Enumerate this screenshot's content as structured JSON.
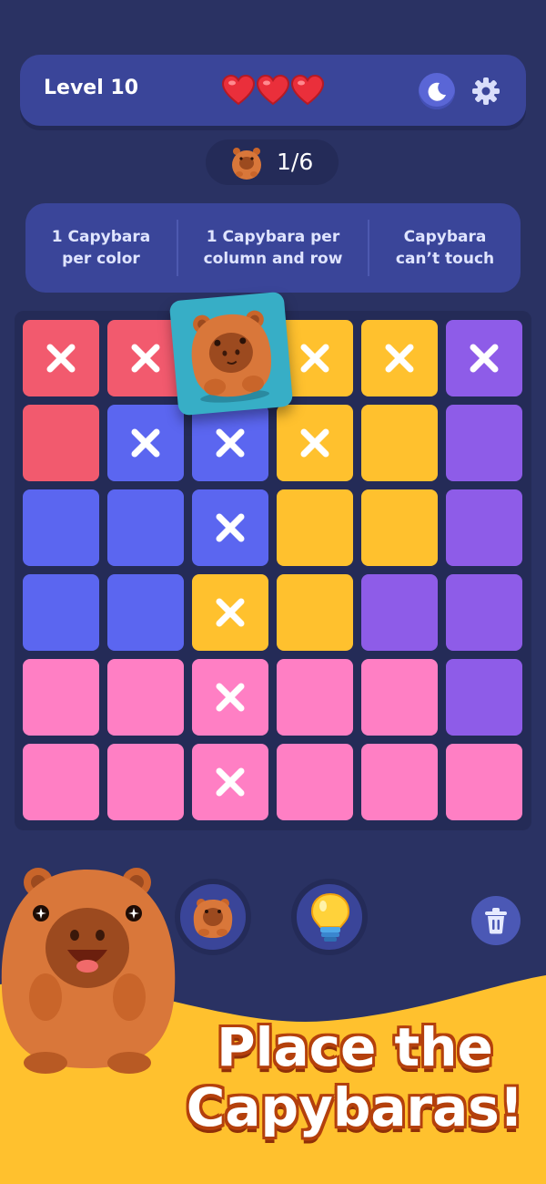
{
  "header": {
    "level_label": "Level 10",
    "lives": 3,
    "theme_icon": "moon-icon",
    "settings_icon": "gear-icon"
  },
  "counter": {
    "text": "1/6",
    "icon": "capybara-icon"
  },
  "rules": [
    {
      "text": "1 Capybara per color"
    },
    {
      "text": "1 Capybara per column and row"
    },
    {
      "text": "Capybara can’t touch"
    }
  ],
  "board": {
    "colors": {
      "red": "#f25a6e",
      "blue": "#5b66f0",
      "yellow": "#ffc12e",
      "purple": "#8e5ce8",
      "pink": "#ff7fc4",
      "selected": "#3ab3c9"
    },
    "rows": [
      [
        "red:x",
        "red:x",
        "blue:capybara",
        "yellow:x",
        "yellow:x",
        "purple:x"
      ],
      [
        "red",
        "blue:x",
        "blue:x",
        "yellow:x",
        "yellow",
        "purple"
      ],
      [
        "blue",
        "blue",
        "blue:x",
        "yellow",
        "yellow",
        "purple"
      ],
      [
        "blue",
        "blue",
        "yellow:x",
        "yellow",
        "purple",
        "purple"
      ],
      [
        "pink",
        "pink",
        "pink:x",
        "pink",
        "pink",
        "purple"
      ],
      [
        "pink",
        "pink",
        "pink:x",
        "pink",
        "pink",
        "pink"
      ]
    ]
  },
  "actions": {
    "capybara_button_icon": "capybara-icon",
    "hint_button_icon": "lightbulb-icon",
    "clear_button_icon": "trash-icon"
  },
  "promo": {
    "line1": "Place the",
    "line2": "Capybaras!"
  }
}
